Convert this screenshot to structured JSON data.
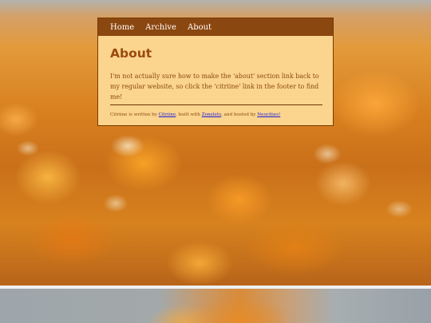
{
  "nav": {
    "items": [
      {
        "label": "Home"
      },
      {
        "label": "Archive"
      },
      {
        "label": "About"
      }
    ]
  },
  "page": {
    "title": "About",
    "body": "I'm not actually sure how to make the 'about' section link back to my regular website, so click the 'citriine' link in the footer to find me!"
  },
  "footer": {
    "text_1": "Citriine is written by ",
    "link_author": "Citriine",
    "text_2": ", built with ",
    "link_builder": "Zonelets",
    "text_3": ", and hosted by ",
    "link_host": "Neocities!"
  },
  "colors": {
    "nav_background": "#8b4710",
    "panel_background": "#fbd48e",
    "title": "#9a4a0d",
    "link": "#1d1ed8"
  }
}
